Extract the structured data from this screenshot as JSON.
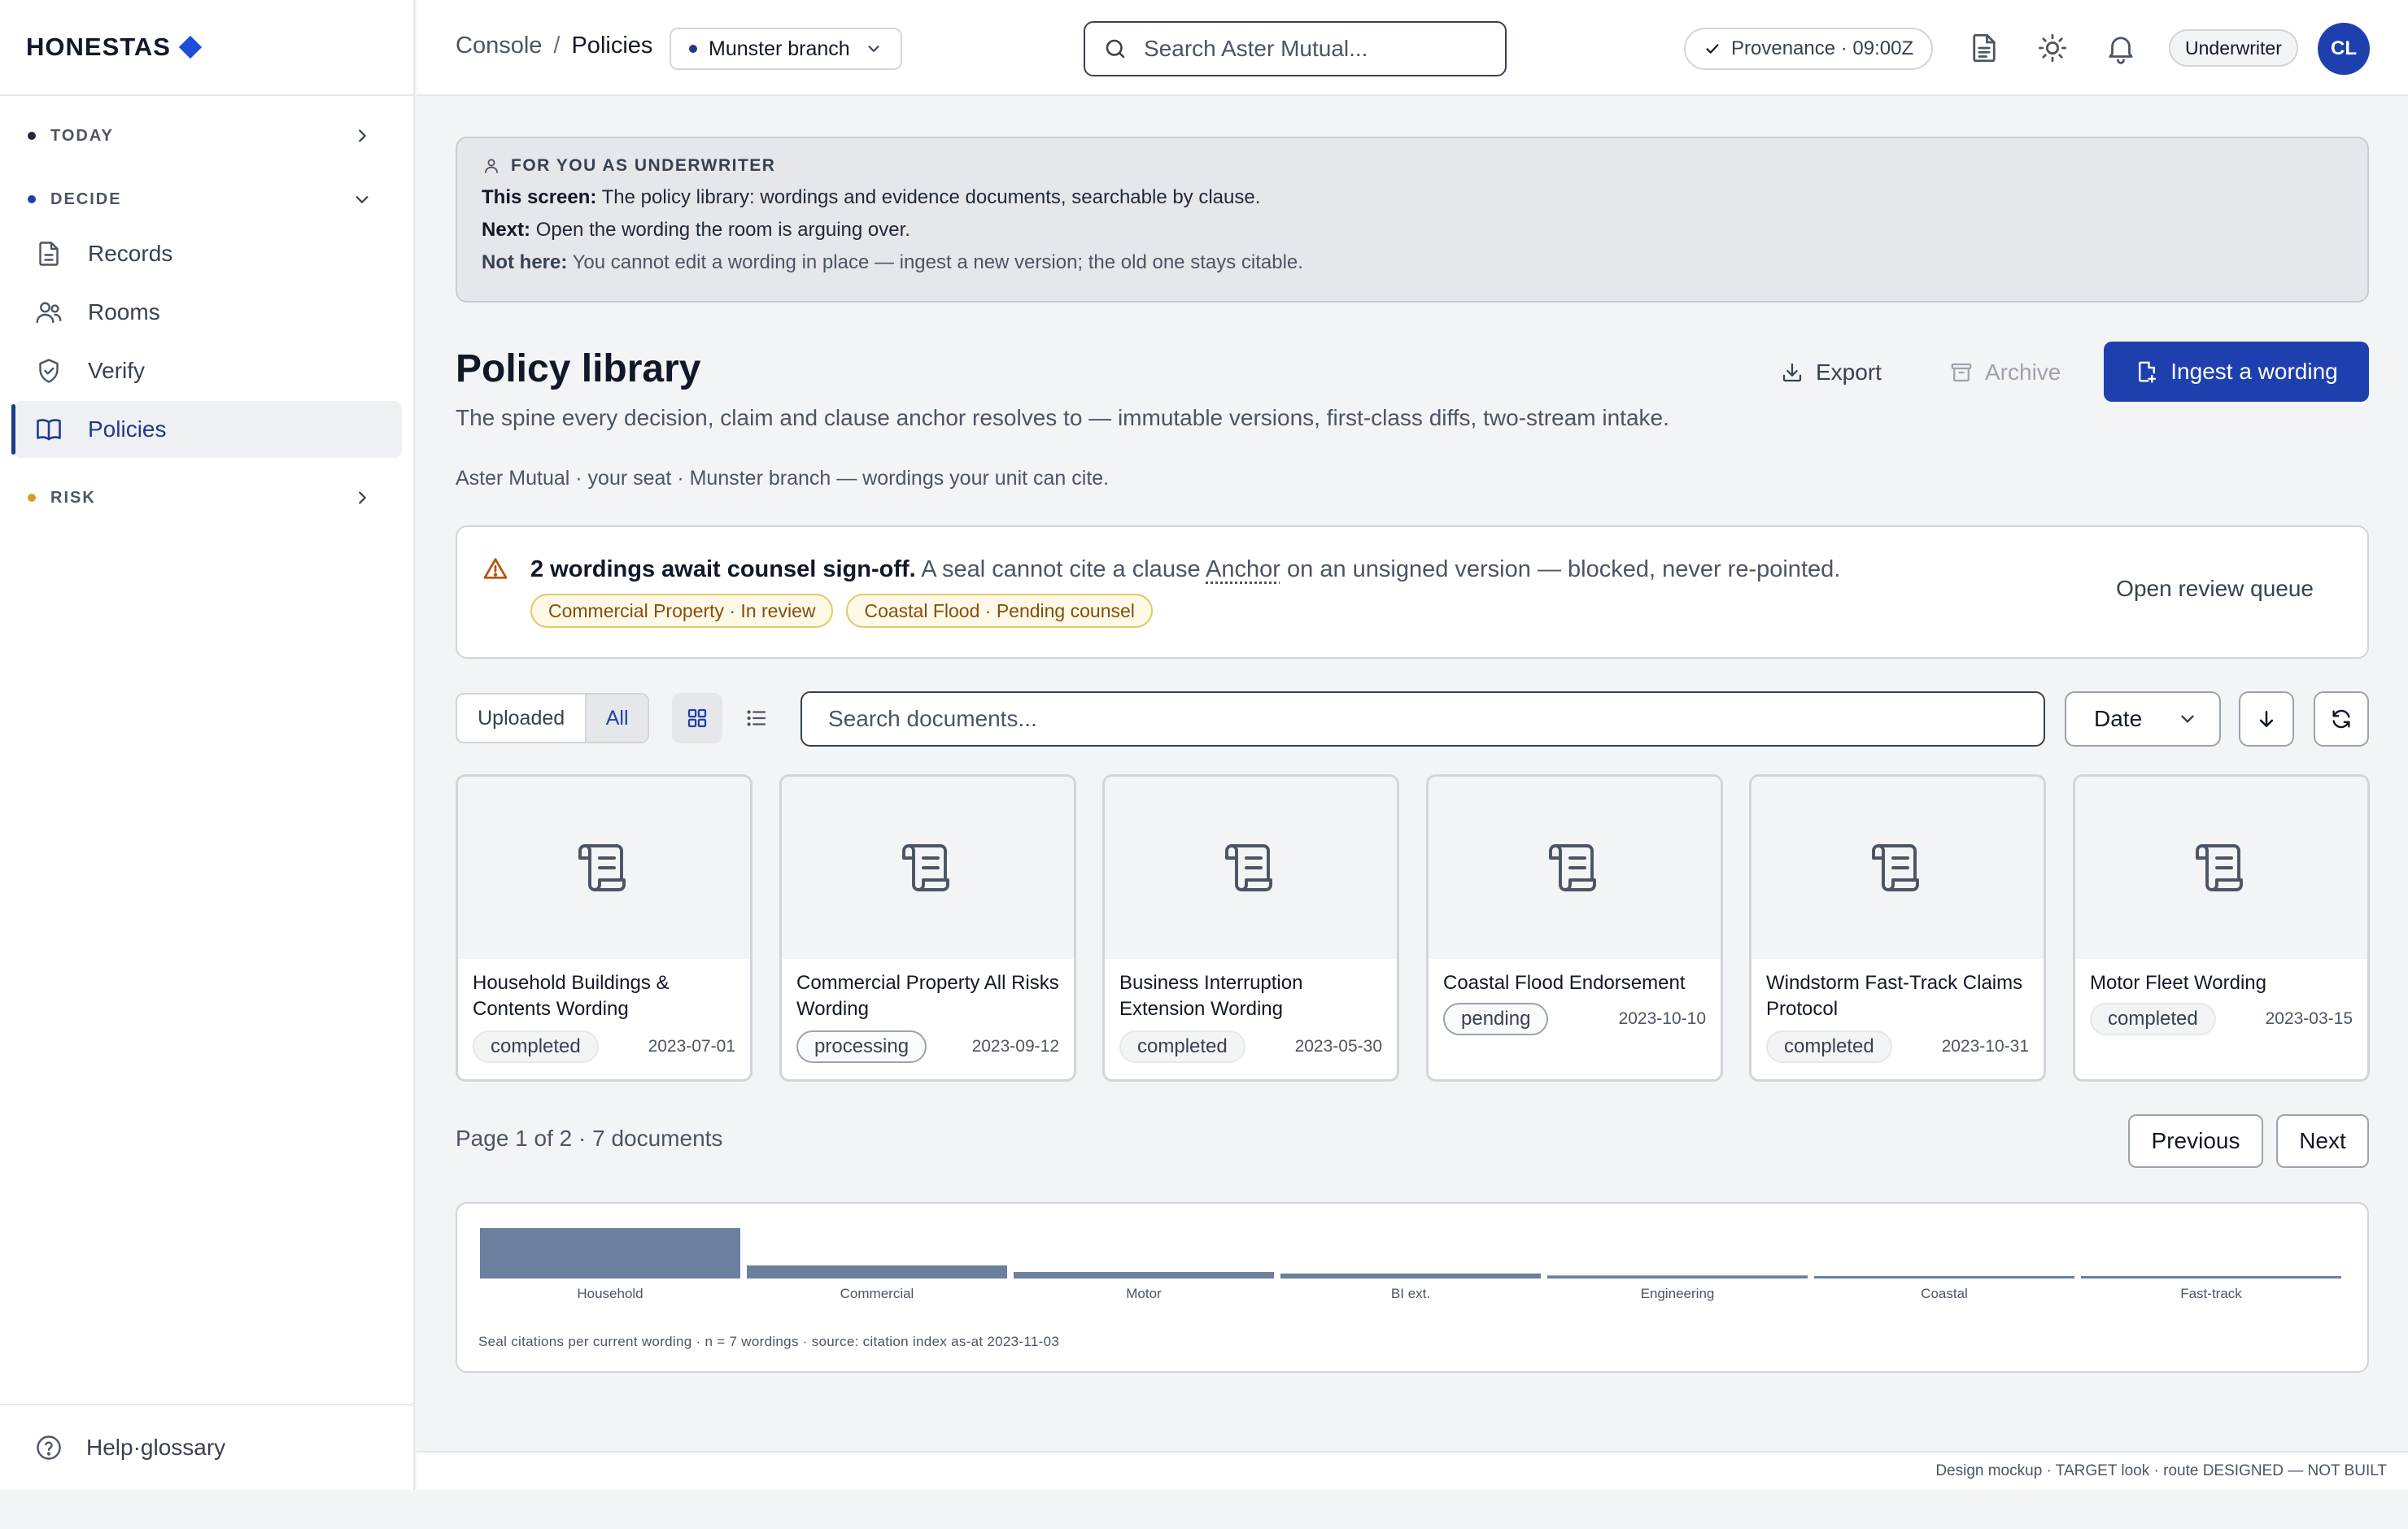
{
  "brand": {
    "name": "HONESTAS",
    "accent": "#1d4ed8"
  },
  "sidebar": {
    "sections": [
      {
        "label": "TODAY",
        "dot_color": "#1f2937"
      },
      {
        "label": "DECIDE",
        "dot_color": "#1e40af"
      },
      {
        "label": "RISK",
        "dot_color": "#d99a2b"
      }
    ],
    "items": [
      {
        "label": "Records",
        "icon": "document-icon"
      },
      {
        "label": "Rooms",
        "icon": "users-icon"
      },
      {
        "label": "Verify",
        "icon": "shield-check-icon"
      },
      {
        "label": "Policies",
        "icon": "book-icon",
        "active": true
      }
    ],
    "footer_label": "Help·glossary"
  },
  "header": {
    "breadcrumb": [
      "Console",
      "Policies"
    ],
    "branch": "Munster branch",
    "search_placeholder": "Search Aster Mutual...",
    "provenance": "Provenance · 09:00Z",
    "role": "Underwriter",
    "avatar": "CL"
  },
  "hint": {
    "heading": "FOR YOU AS UNDERWRITER",
    "lines": [
      {
        "label": "This screen:",
        "text": "The policy library: wordings and evidence documents, searchable by clause."
      },
      {
        "label": "Next:",
        "text": "Open the wording the room is arguing over."
      },
      {
        "label": "Not here:",
        "text": "You cannot edit a wording in place — ingest a new version; the old one stays citable."
      }
    ]
  },
  "page": {
    "title": "Policy library",
    "subtitle": "The spine every decision, claim and clause anchor resolves to — immutable versions, first-class diffs, two-stream intake.",
    "scope": "Aster Mutual · your seat · Munster branch — wordings your unit can cite.",
    "actions": {
      "export": "Export",
      "archive": "Archive",
      "ingest": "Ingest a wording"
    }
  },
  "alert": {
    "bold": "2 wordings await counsel sign-off.",
    "text_before": "A seal cannot cite a clause",
    "anchor_word": "Anchor",
    "text_after": "on an unsigned version — blocked, never re-pointed.",
    "chips": [
      "Commercial Property · In review",
      "Coastal Flood · Pending counsel"
    ],
    "link": "Open review queue"
  },
  "toolbar": {
    "segments": [
      "Uploaded",
      "All"
    ],
    "active_segment": "All",
    "search_placeholder": "Search documents...",
    "sort": "Date"
  },
  "documents": [
    {
      "title": "Household Buildings & Contents Wording",
      "status": "completed",
      "date": "2023-07-01"
    },
    {
      "title": "Commercial Property All Risks Wording",
      "status": "processing",
      "date": "2023-09-12"
    },
    {
      "title": "Business Interruption Extension Wording",
      "status": "completed",
      "date": "2023-05-30"
    },
    {
      "title": "Coastal Flood Endorsement",
      "status": "pending",
      "date": "2023-10-10"
    },
    {
      "title": "Windstorm Fast-Track Claims Protocol",
      "status": "completed",
      "date": "2023-10-31"
    },
    {
      "title": "Motor Fleet Wording",
      "status": "completed",
      "date": "2023-03-15"
    }
  ],
  "pagination": {
    "info": "Page 1 of 2 · 7 documents",
    "previous": "Previous",
    "next": "Next"
  },
  "chart_data": {
    "type": "bar",
    "categories": [
      "Household",
      "Commercial",
      "Motor",
      "BI ext.",
      "Engineering",
      "Coastal",
      "Fast-track"
    ],
    "values": [
      100,
      26,
      13,
      10,
      6,
      3,
      1
    ],
    "bar_color": "#6b7f9e",
    "caption": "Seal citations per current wording · n = 7 wordings · source: citation index as-at 2023-11-03",
    "ylim": [
      0,
      100
    ],
    "grid": false
  },
  "footer": "Design mockup · TARGET look · route DESIGNED — NOT BUILT"
}
